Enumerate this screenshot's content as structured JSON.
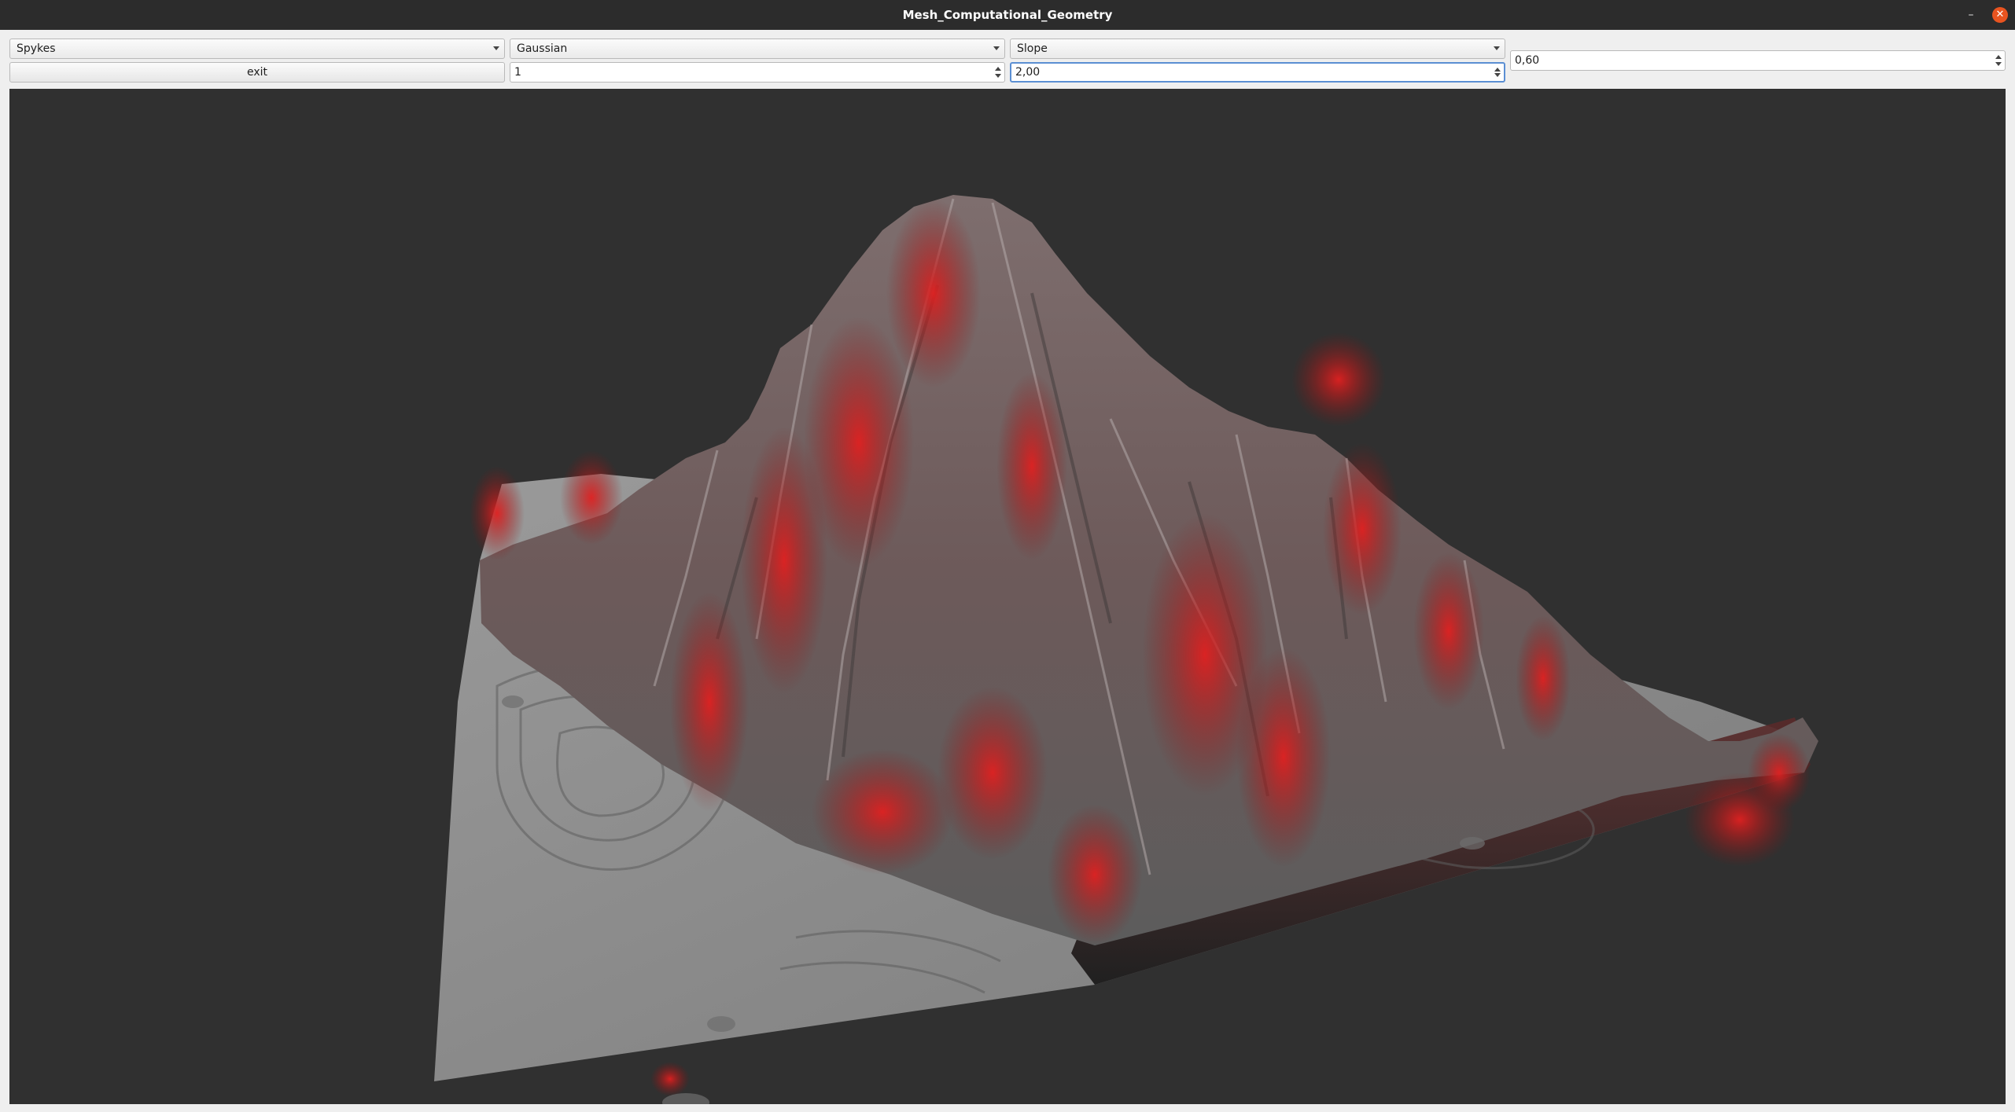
{
  "window": {
    "title": "Mesh_Computational_Geometry",
    "minimize_glyph": "–",
    "close_glyph": "✕"
  },
  "toolbar": {
    "shape_combo": {
      "value": "Spykes"
    },
    "filter_combo": {
      "value": "Gaussian"
    },
    "coloring_combo": {
      "value": "Slope"
    },
    "threshold_spin": {
      "value": "0,60"
    },
    "exit_label": "exit",
    "iterations_spin": {
      "value": "1"
    },
    "scale_spin": {
      "value": "2,00"
    }
  },
  "viewport": {
    "background": "#303030",
    "terrain_base_color": "#8e8e8e",
    "slope_highlight_color": "#d81a1a"
  },
  "icons": {
    "dropdown": "chevron-down-icon",
    "spin_up": "arrow-up-icon",
    "spin_down": "arrow-down-icon",
    "close": "close-icon",
    "minimize": "minimize-icon"
  }
}
